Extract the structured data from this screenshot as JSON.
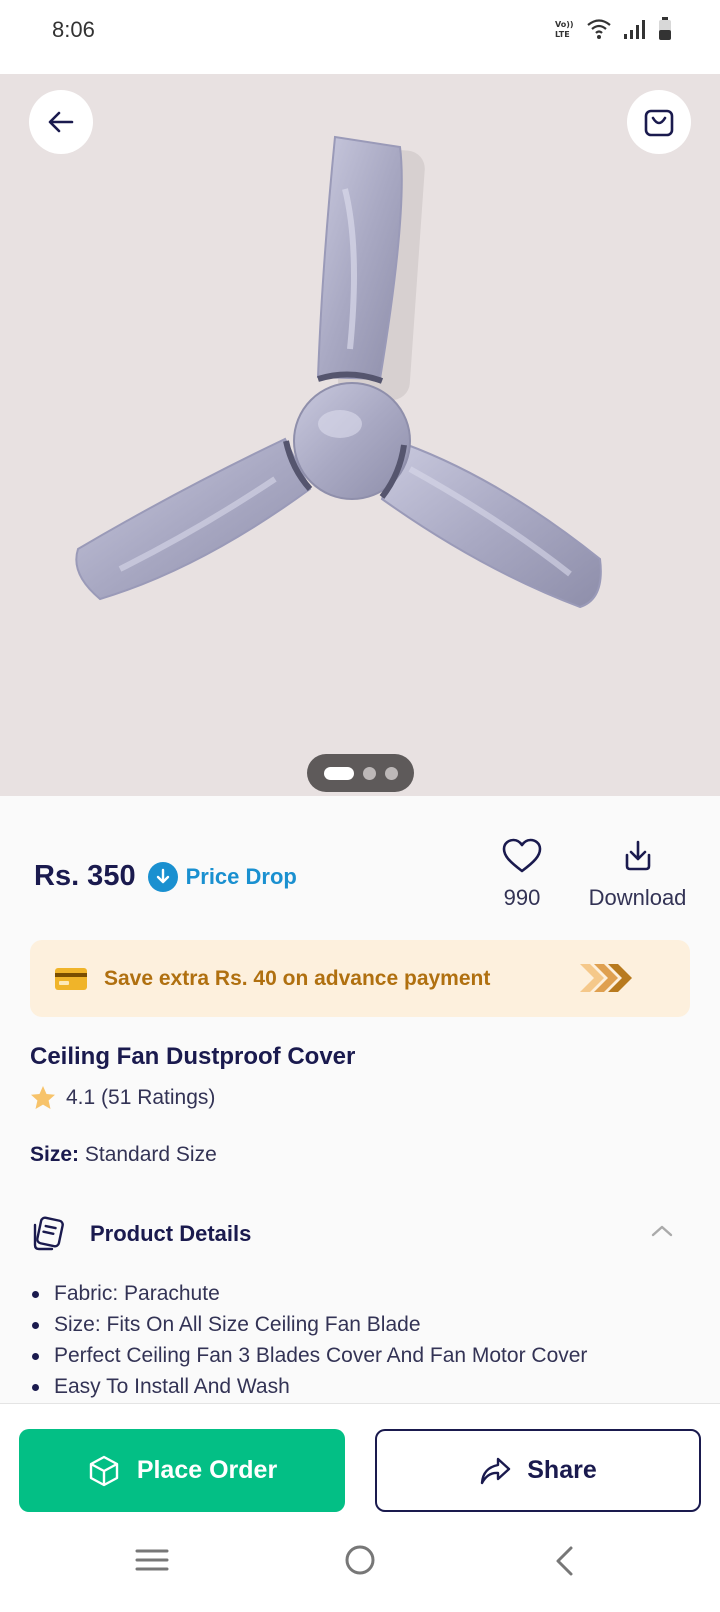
{
  "status_bar": {
    "time": "8:06",
    "volte_label": "Vo)) LTE",
    "icons": [
      "volte-icon",
      "wifi-icon",
      "signal-icon",
      "battery-icon"
    ]
  },
  "hero": {
    "icons": [
      "back-arrow-icon",
      "shopping-bag-icon"
    ],
    "image": "ceiling-fan-cover-image",
    "pager": {
      "count": 3,
      "active_index": 0
    }
  },
  "price": {
    "amount": "Rs. 350",
    "drop_label": "Price Drop",
    "drop_color": "#1a90d0"
  },
  "actions": {
    "wishlist_count": "990",
    "download_label": "Download"
  },
  "offer": {
    "text": "Save extra Rs. 40 on advance payment",
    "bg_color": "#fdf0dd",
    "text_color": "#b07010"
  },
  "product": {
    "title": "Ceiling Fan Dustproof Cover",
    "rating": "4.1 (51 Ratings)",
    "size_label": "Size:",
    "size_value": "Standard Size"
  },
  "details": {
    "title": "Product Details",
    "items": [
      "Fabric: Parachute",
      "Size: Fits On All Size Ceiling Fan Blade",
      "Perfect Ceiling Fan 3 Blades Cover And Fan Motor Cover",
      "Easy To Install And Wash"
    ]
  },
  "bottom": {
    "place_order": "Place Order",
    "share": "Share",
    "accent_color": "#03bf85"
  },
  "nav": {
    "icons": [
      "menu-icon",
      "home-circle-icon",
      "back-chevron-icon"
    ]
  }
}
